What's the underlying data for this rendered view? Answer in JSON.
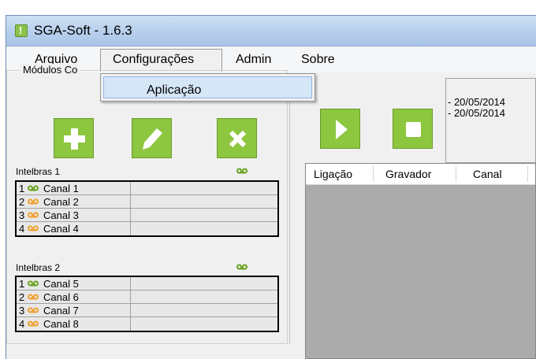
{
  "window": {
    "title": "SGA-Soft - 1.6.3"
  },
  "menu": {
    "items": [
      "Arquivo",
      "Configurações",
      "Admin",
      "Sobre"
    ],
    "open_dropdown": {
      "items": [
        "Aplicação"
      ]
    }
  },
  "modules_group": {
    "label": "Módulos Co",
    "buttons": [
      {
        "icon": "plus-icon"
      },
      {
        "icon": "pencil-icon"
      },
      {
        "icon": "x-icon"
      }
    ],
    "modules": [
      {
        "name": "Intelbras 1",
        "channels": [
          {
            "num": "1",
            "name": "Canal 1",
            "status": "active"
          },
          {
            "num": "2",
            "name": "Canal 2",
            "status": "idle"
          },
          {
            "num": "3",
            "name": "Canal 3",
            "status": "idle"
          },
          {
            "num": "4",
            "name": "Canal 4",
            "status": "idle"
          }
        ]
      },
      {
        "name": "Intelbras 2",
        "channels": [
          {
            "num": "1",
            "name": "Canal 5",
            "status": "active"
          },
          {
            "num": "2",
            "name": "Canal 6",
            "status": "idle"
          },
          {
            "num": "3",
            "name": "Canal 7",
            "status": "idle"
          },
          {
            "num": "4",
            "name": "Canal 8",
            "status": "idle"
          }
        ]
      }
    ]
  },
  "controls": [
    {
      "icon": "play-icon"
    },
    {
      "icon": "stop-icon"
    }
  ],
  "log": {
    "lines": [
      "- 20/05/2014",
      "- 20/05/2014"
    ]
  },
  "table": {
    "columns": [
      "Ligação",
      "Gravador",
      "Canal"
    ]
  },
  "colors": {
    "accent_green": "#8dc63f",
    "tape_active": "#6aa321",
    "tape_idle": "#f0a030"
  }
}
